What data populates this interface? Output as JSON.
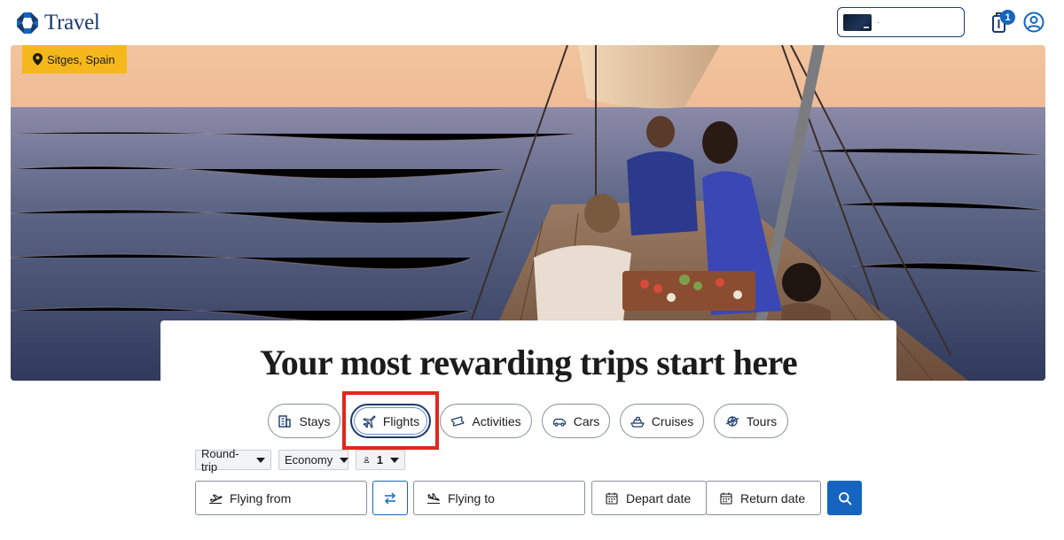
{
  "header": {
    "logo_text": "Travel",
    "selected_card": "·",
    "trips_count": "1"
  },
  "hero": {
    "location": "Sitges, Spain",
    "headline": "Your most rewarding trips start here"
  },
  "tabs": [
    {
      "label": "Stays",
      "icon": "hotel-building-icon"
    },
    {
      "label": "Flights",
      "icon": "airplane-icon",
      "active": true
    },
    {
      "label": "Activities",
      "icon": "ticket-icon"
    },
    {
      "label": "Cars",
      "icon": "car-icon"
    },
    {
      "label": "Cruises",
      "icon": "ship-icon"
    },
    {
      "label": "Tours",
      "icon": "globe-icon"
    }
  ],
  "options": {
    "trip_type": "Round-trip",
    "cabin": "Economy",
    "travelers": "1"
  },
  "search": {
    "from_placeholder": "Flying from",
    "to_placeholder": "Flying to",
    "depart_placeholder": "Depart date",
    "return_placeholder": "Return date"
  },
  "colors": {
    "brand_navy": "#1a3b6e",
    "accent_blue": "#1565c0",
    "location_tag": "#f5b81c",
    "highlight_red": "#e3261b"
  }
}
